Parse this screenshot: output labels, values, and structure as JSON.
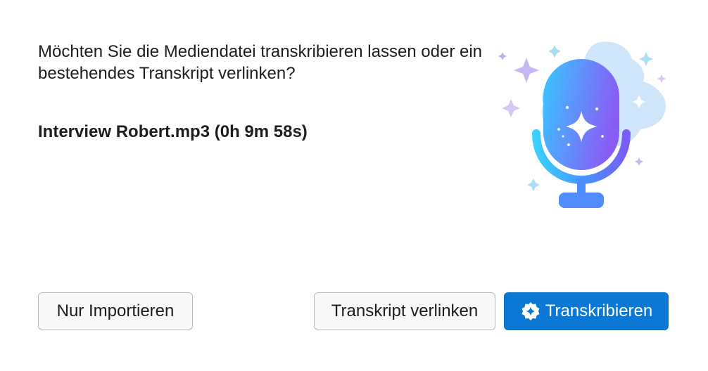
{
  "dialog": {
    "question": "Möchten Sie die Mediendatei transkribieren lassen oder ein bestehendes Transkript verlinken?",
    "file": "Interview Robert.mp3 (0h 9m 58s)"
  },
  "buttons": {
    "import_label": "Nur Importieren",
    "link_label": "Transkript verlinken",
    "transcribe_label": "Transkribieren",
    "transcribe_icon": "sparkle-badge-icon"
  },
  "illustration": {
    "icon": "microphone-sparkle-icon"
  },
  "colors": {
    "primary": "#0b78d6",
    "mic_gradient_start": "#35c8ff",
    "mic_gradient_end": "#8a5cf6",
    "cloud": "#cfe6fb",
    "sparkle": "#c9b6f5"
  }
}
